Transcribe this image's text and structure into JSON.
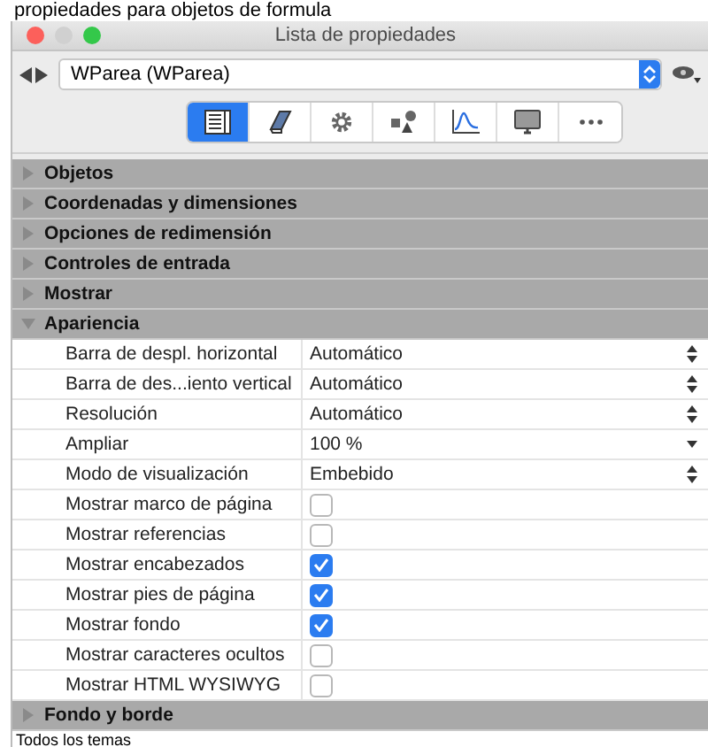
{
  "page_heading": "propiedades para objetos de formula",
  "window": {
    "title": "Lista de propiedades"
  },
  "object_selector": {
    "value": "WParea (WParea)"
  },
  "toolbar_tabs": [
    {
      "kind": "list",
      "selected": true
    },
    {
      "kind": "book",
      "selected": false
    },
    {
      "kind": "gear",
      "selected": false
    },
    {
      "kind": "shapes",
      "selected": false
    },
    {
      "kind": "graph",
      "selected": false
    },
    {
      "kind": "monitor",
      "selected": false
    },
    {
      "kind": "more",
      "selected": false
    }
  ],
  "sections": [
    {
      "title": "Objetos",
      "expanded": false
    },
    {
      "title": "Coordenadas y dimensiones",
      "expanded": false
    },
    {
      "title": "Opciones de redimensión",
      "expanded": false
    },
    {
      "title": "Controles de entrada",
      "expanded": false
    },
    {
      "title": "Mostrar",
      "expanded": false
    },
    {
      "title": "Apariencia",
      "expanded": true,
      "properties": [
        {
          "label": "Barra de despl. horizontal",
          "kind": "select",
          "value": "Automático"
        },
        {
          "label": "Barra de des...iento vertical",
          "kind": "select",
          "value": "Automático"
        },
        {
          "label": "Resolución",
          "kind": "select",
          "value": "Automático"
        },
        {
          "label": "Ampliar",
          "kind": "menu",
          "value": "100 %"
        },
        {
          "label": "Modo de visualización",
          "kind": "select",
          "value": "Embebido"
        },
        {
          "label": "Mostrar marco de página",
          "kind": "checkbox",
          "checked": false
        },
        {
          "label": "Mostrar referencias",
          "kind": "checkbox",
          "checked": false
        },
        {
          "label": "Mostrar encabezados",
          "kind": "checkbox",
          "checked": true
        },
        {
          "label": "Mostrar pies de página",
          "kind": "checkbox",
          "checked": true
        },
        {
          "label": "Mostrar fondo",
          "kind": "checkbox",
          "checked": true
        },
        {
          "label": "Mostrar caracteres ocultos",
          "kind": "checkbox",
          "checked": false
        },
        {
          "label": "Mostrar HTML WYSIWYG",
          "kind": "checkbox",
          "checked": false
        }
      ]
    },
    {
      "title": "Fondo y borde",
      "expanded": false
    }
  ],
  "footer": "Todos los temas"
}
